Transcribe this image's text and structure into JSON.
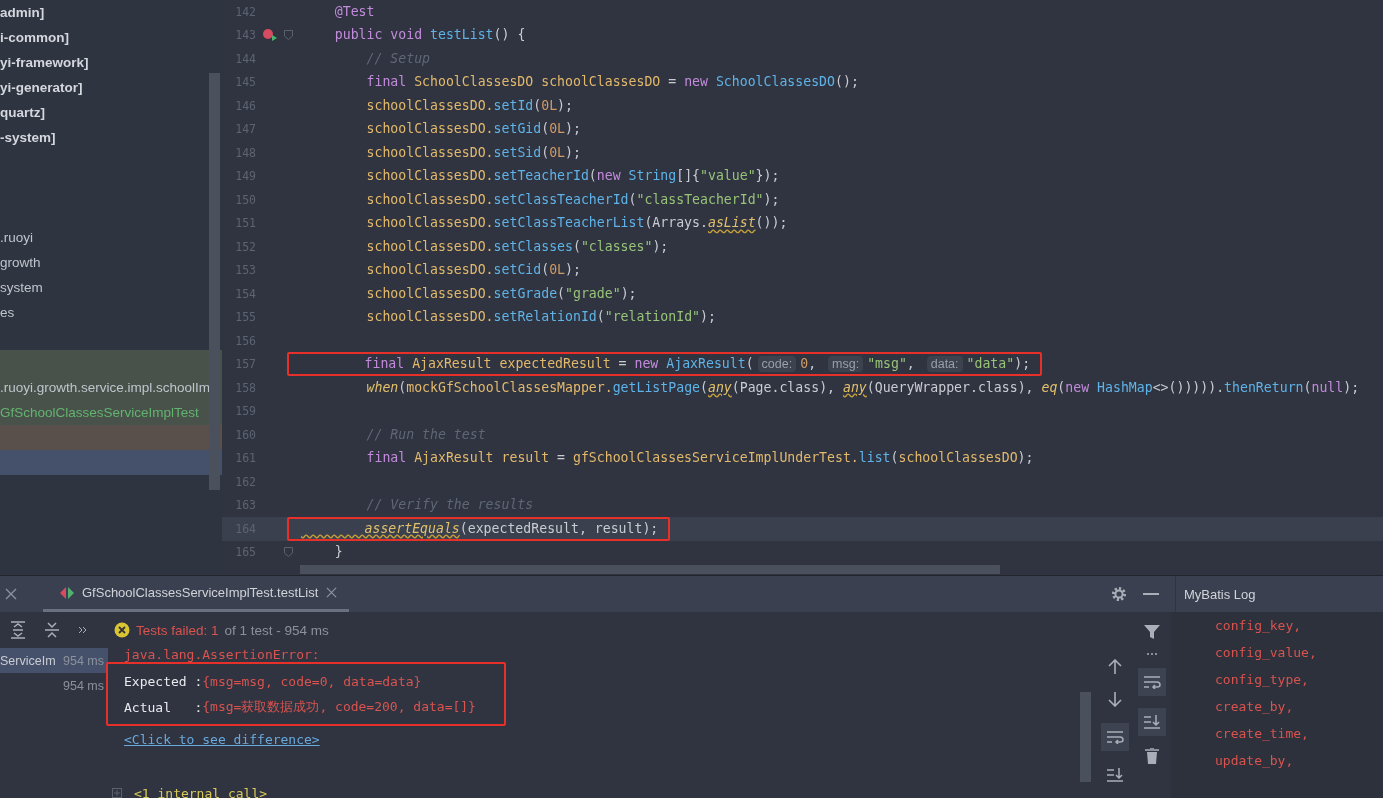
{
  "project_tree": {
    "rows": [
      {
        "kind": "module",
        "label": "admin]",
        "selected": false
      },
      {
        "kind": "module",
        "label": "i-common]",
        "selected": false
      },
      {
        "kind": "module",
        "label": "yi-framework]",
        "selected": false
      },
      {
        "kind": "module",
        "label": "yi-generator]",
        "selected": false
      },
      {
        "kind": "module",
        "label": "quartz]",
        "selected": false
      },
      {
        "kind": "module",
        "label": "-system]",
        "selected": false
      },
      {
        "kind": "blank",
        "selected": false
      },
      {
        "kind": "blank",
        "selected": false
      },
      {
        "kind": "blank",
        "selected": false
      },
      {
        "kind": "package",
        "label": ".ruoyi",
        "selected": false
      },
      {
        "kind": "package",
        "label": "growth",
        "selected": false
      },
      {
        "kind": "package",
        "label": "system",
        "selected": false
      },
      {
        "kind": "package",
        "label": "es",
        "selected": false
      },
      {
        "kind": "blank",
        "selected": false
      },
      {
        "kind": "blank",
        "color": "#48524a",
        "selected": false
      },
      {
        "kind": "package",
        "label": ".ruoyi.growth.service.impl.schoolIm",
        "color": "#48524a",
        "selected": false
      },
      {
        "kind": "class",
        "label": "GfSchoolClassesServiceImplTest",
        "color": "#48524a",
        "selected": false
      },
      {
        "kind": "blank",
        "color": "#59504b",
        "selected": false
      },
      {
        "kind": "blank",
        "selected": true
      }
    ]
  },
  "editor": {
    "lines": [
      {
        "number": "142",
        "current": false,
        "boxed": false,
        "run_icon": false,
        "fold": false,
        "tokens": [
          {
            "kind": "annotation",
            "text": "    @Test"
          }
        ]
      },
      {
        "number": "143",
        "current": false,
        "boxed": false,
        "run_icon": true,
        "fold": true,
        "tokens": [
          {
            "kind": "keyword",
            "text": "    public void "
          },
          {
            "kind": "method",
            "text": "testList"
          },
          {
            "kind": "plain",
            "text": "() {"
          }
        ]
      },
      {
        "number": "144",
        "current": false,
        "boxed": false,
        "run_icon": false,
        "fold": false,
        "tokens": [
          {
            "kind": "comment",
            "text": "        // Setup"
          }
        ]
      },
      {
        "number": "145",
        "current": false,
        "boxed": false,
        "run_icon": false,
        "fold": false,
        "tokens": [
          {
            "kind": "keyword",
            "text": "        final "
          },
          {
            "kind": "type",
            "text": "SchoolClassesDO "
          },
          {
            "kind": "variable",
            "text": "schoolClassesDO "
          },
          {
            "kind": "plain",
            "text": "= "
          },
          {
            "kind": "keyword",
            "text": "new "
          },
          {
            "kind": "method",
            "text": "SchoolClassesDO"
          },
          {
            "kind": "plain",
            "text": "();"
          }
        ]
      },
      {
        "number": "146",
        "current": false,
        "boxed": false,
        "run_icon": false,
        "fold": false,
        "tokens": [
          {
            "kind": "variable",
            "text": "        schoolClassesDO."
          },
          {
            "kind": "method",
            "text": "setId"
          },
          {
            "kind": "plain",
            "text": "("
          },
          {
            "kind": "number",
            "text": "0L"
          },
          {
            "kind": "plain",
            "text": ");"
          }
        ]
      },
      {
        "number": "147",
        "current": false,
        "boxed": false,
        "run_icon": false,
        "fold": false,
        "tokens": [
          {
            "kind": "variable",
            "text": "        schoolClassesDO."
          },
          {
            "kind": "method",
            "text": "setGid"
          },
          {
            "kind": "plain",
            "text": "("
          },
          {
            "kind": "number",
            "text": "0L"
          },
          {
            "kind": "plain",
            "text": ");"
          }
        ]
      },
      {
        "number": "148",
        "current": false,
        "boxed": false,
        "run_icon": false,
        "fold": false,
        "tokens": [
          {
            "kind": "variable",
            "text": "        schoolClassesDO."
          },
          {
            "kind": "method",
            "text": "setSid"
          },
          {
            "kind": "plain",
            "text": "("
          },
          {
            "kind": "number",
            "text": "0L"
          },
          {
            "kind": "plain",
            "text": ");"
          }
        ]
      },
      {
        "number": "149",
        "current": false,
        "boxed": false,
        "run_icon": false,
        "fold": false,
        "tokens": [
          {
            "kind": "variable",
            "text": "        schoolClassesDO."
          },
          {
            "kind": "method",
            "text": "setTeacherId"
          },
          {
            "kind": "plain",
            "text": "("
          },
          {
            "kind": "keyword",
            "text": "new "
          },
          {
            "kind": "method",
            "text": "String"
          },
          {
            "kind": "plain",
            "text": "[]{"
          },
          {
            "kind": "string",
            "text": "\"value\""
          },
          {
            "kind": "plain",
            "text": "});"
          }
        ]
      },
      {
        "number": "150",
        "current": false,
        "boxed": false,
        "run_icon": false,
        "fold": false,
        "tokens": [
          {
            "kind": "variable",
            "text": "        schoolClassesDO."
          },
          {
            "kind": "method",
            "text": "setClassTeacherId"
          },
          {
            "kind": "plain",
            "text": "("
          },
          {
            "kind": "string",
            "text": "\"classTeacherId\""
          },
          {
            "kind": "plain",
            "text": ");"
          }
        ]
      },
      {
        "number": "151",
        "current": false,
        "boxed": false,
        "run_icon": false,
        "fold": false,
        "tokens": [
          {
            "kind": "variable",
            "text": "        schoolClassesDO."
          },
          {
            "kind": "method",
            "text": "setClassTeacherList"
          },
          {
            "kind": "plain",
            "text": "(Arrays."
          },
          {
            "kind": "static_warning",
            "text": "asList"
          },
          {
            "kind": "plain",
            "text": "());"
          }
        ]
      },
      {
        "number": "152",
        "current": false,
        "boxed": false,
        "run_icon": false,
        "fold": false,
        "tokens": [
          {
            "kind": "variable",
            "text": "        schoolClassesDO."
          },
          {
            "kind": "method",
            "text": "setClasses"
          },
          {
            "kind": "plain",
            "text": "("
          },
          {
            "kind": "string",
            "text": "\"classes\""
          },
          {
            "kind": "plain",
            "text": ");"
          }
        ]
      },
      {
        "number": "153",
        "current": false,
        "boxed": false,
        "run_icon": false,
        "fold": false,
        "tokens": [
          {
            "kind": "variable",
            "text": "        schoolClassesDO."
          },
          {
            "kind": "method",
            "text": "setCid"
          },
          {
            "kind": "plain",
            "text": "("
          },
          {
            "kind": "number",
            "text": "0L"
          },
          {
            "kind": "plain",
            "text": ");"
          }
        ]
      },
      {
        "number": "154",
        "current": false,
        "boxed": false,
        "run_icon": false,
        "fold": false,
        "tokens": [
          {
            "kind": "variable",
            "text": "        schoolClassesDO."
          },
          {
            "kind": "method",
            "text": "setGrade"
          },
          {
            "kind": "plain",
            "text": "("
          },
          {
            "kind": "string",
            "text": "\"grade\""
          },
          {
            "kind": "plain",
            "text": ");"
          }
        ]
      },
      {
        "number": "155",
        "current": false,
        "boxed": false,
        "run_icon": false,
        "fold": false,
        "tokens": [
          {
            "kind": "variable",
            "text": "        schoolClassesDO."
          },
          {
            "kind": "method",
            "text": "setRelationId"
          },
          {
            "kind": "plain",
            "text": "("
          },
          {
            "kind": "string",
            "text": "\"relationId\""
          },
          {
            "kind": "plain",
            "text": ");"
          }
        ]
      },
      {
        "number": "156",
        "current": false,
        "boxed": false,
        "run_icon": false,
        "fold": false
      },
      {
        "number": "157",
        "current": false,
        "boxed": true,
        "run_icon": false,
        "fold": false,
        "tokens": [
          {
            "kind": "keyword",
            "text": "        final "
          },
          {
            "kind": "type",
            "text": "AjaxResult "
          },
          {
            "kind": "variable",
            "text": "expectedResult "
          },
          {
            "kind": "plain",
            "text": "= "
          },
          {
            "kind": "keyword",
            "text": "new "
          },
          {
            "kind": "method",
            "text": "AjaxResult"
          },
          {
            "kind": "plain",
            "text": "("
          },
          {
            "kind": "hint",
            "text": "code:"
          },
          {
            "kind": "number",
            "text": "0"
          },
          {
            "kind": "plain",
            "text": ", "
          },
          {
            "kind": "hint",
            "text": "msg:"
          },
          {
            "kind": "string",
            "text": "\"msg\""
          },
          {
            "kind": "plain",
            "text": ", "
          },
          {
            "kind": "hint",
            "text": "data:"
          },
          {
            "kind": "string",
            "text": "\"data\""
          },
          {
            "kind": "plain",
            "text": ");"
          }
        ]
      },
      {
        "number": "158",
        "current": false,
        "boxed": false,
        "run_icon": false,
        "fold": false,
        "tokens": [
          {
            "kind": "static",
            "text": "        when"
          },
          {
            "kind": "plain",
            "text": "("
          },
          {
            "kind": "variable",
            "text": "mockGfSchoolClassesMapper."
          },
          {
            "kind": "method",
            "text": "getListPage"
          },
          {
            "kind": "plain",
            "text": "("
          },
          {
            "kind": "static_warning",
            "text": "any"
          },
          {
            "kind": "plain",
            "text": "(Page.class), "
          },
          {
            "kind": "static_warning",
            "text": "any"
          },
          {
            "kind": "plain",
            "text": "(QueryWrapper.class), "
          },
          {
            "kind": "static",
            "text": "eq"
          },
          {
            "kind": "plain",
            "text": "("
          },
          {
            "kind": "keyword",
            "text": "new "
          },
          {
            "kind": "method",
            "text": "HashMap"
          },
          {
            "kind": "plain",
            "text": "<>()))))."
          },
          {
            "kind": "method",
            "text": "thenReturn"
          },
          {
            "kind": "plain",
            "text": "("
          },
          {
            "kind": "keyword",
            "text": "null"
          },
          {
            "kind": "plain",
            "text": ");"
          }
        ]
      },
      {
        "number": "159",
        "current": false,
        "boxed": false,
        "run_icon": false,
        "fold": false
      },
      {
        "number": "160",
        "current": false,
        "boxed": false,
        "run_icon": false,
        "fold": false,
        "tokens": [
          {
            "kind": "comment",
            "text": "        // Run the test"
          }
        ]
      },
      {
        "number": "161",
        "current": false,
        "boxed": false,
        "run_icon": false,
        "fold": false,
        "tokens": [
          {
            "kind": "keyword",
            "text": "        final "
          },
          {
            "kind": "type",
            "text": "AjaxResult "
          },
          {
            "kind": "variable",
            "text": "result "
          },
          {
            "kind": "plain",
            "text": "= "
          },
          {
            "kind": "variable",
            "text": "gfSchoolClassesServiceImplUnderTest."
          },
          {
            "kind": "method",
            "text": "list"
          },
          {
            "kind": "plain",
            "text": "("
          },
          {
            "kind": "variable",
            "text": "schoolClassesDO"
          },
          {
            "kind": "plain",
            "text": ");"
          }
        ]
      },
      {
        "number": "162",
        "current": false,
        "boxed": false,
        "run_icon": false,
        "fold": false
      },
      {
        "number": "163",
        "current": false,
        "boxed": false,
        "run_icon": false,
        "fold": false,
        "tokens": [
          {
            "kind": "comment",
            "text": "        // Verify the results"
          }
        ]
      },
      {
        "number": "164",
        "current": true,
        "boxed": true,
        "run_icon": false,
        "fold": false,
        "tokens": [
          {
            "kind": "static_warning",
            "text": "        assertEquals"
          },
          {
            "kind": "plain",
            "text": "(expectedResult, result);"
          }
        ]
      },
      {
        "number": "165",
        "current": false,
        "boxed": false,
        "run_icon": false,
        "fold": true,
        "tokens": [
          {
            "kind": "plain",
            "text": "    }"
          }
        ]
      }
    ]
  },
  "run_panel": {
    "tab": {
      "label": "GfSchoolClassesServiceImplTest.testList",
      "selected": true
    },
    "status_label": "Tests failed: 1",
    "status_detail": "of 1 test - 954 ms",
    "tests": [
      {
        "name": "ServiceIm",
        "time": "954 ms",
        "selected": true
      },
      {
        "time": "954 ms",
        "selected": false
      }
    ],
    "console": {
      "error": "java.lang.AssertionError:",
      "expected_label": "Expected :",
      "expected_value": "{msg=msg, code=0, data=data}",
      "actual_label": "Actual   :",
      "actual_value": "{msg=获取数据成功, code=200, data=[]}",
      "link": "<Click to see difference>",
      "internal_call": "<1 internal call>"
    }
  },
  "mybatis_log": {
    "title": "MyBatis Log",
    "lines": [
      "config_key,",
      "config_value,",
      "config_type,",
      "create_by,",
      "create_time,",
      "update_by,"
    ]
  }
}
